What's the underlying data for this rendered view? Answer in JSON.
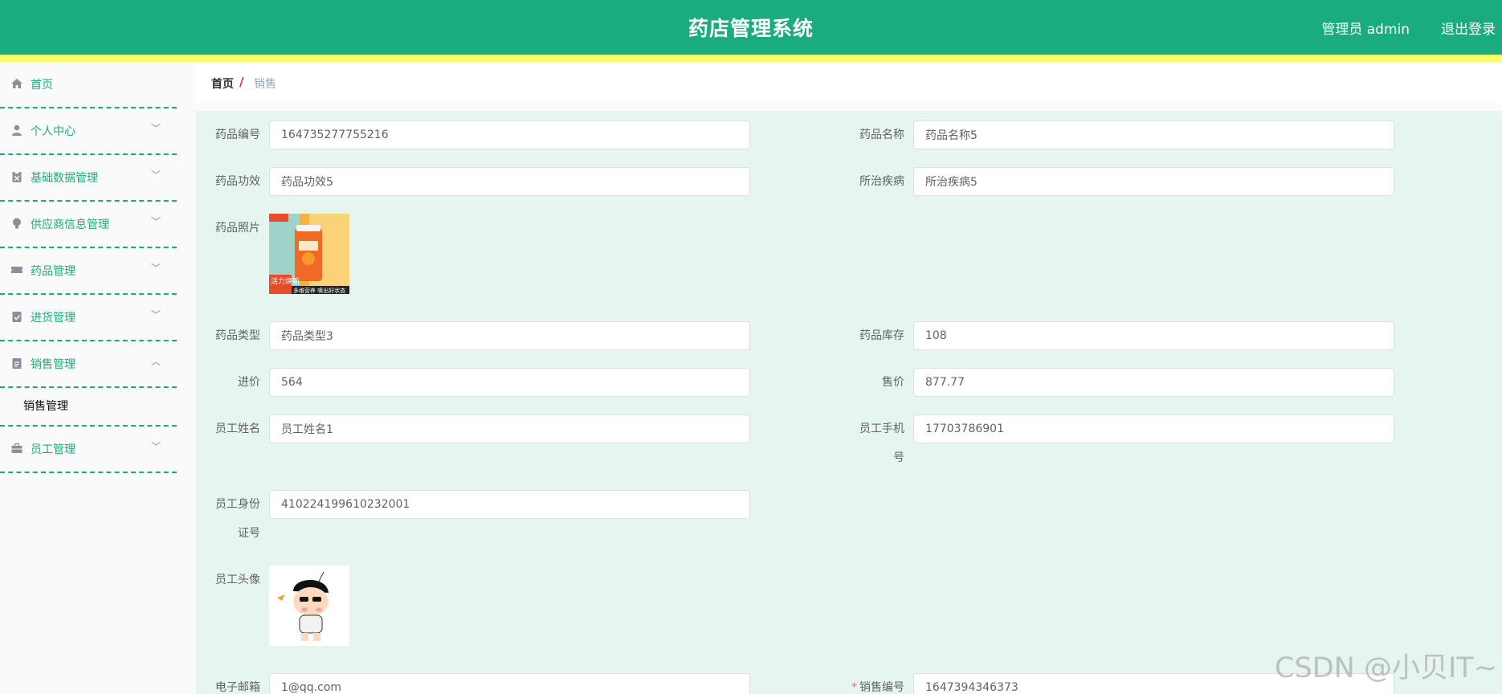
{
  "header": {
    "title": "药店管理系统",
    "admin_label": "管理员 admin",
    "logout_label": "退出登录"
  },
  "sidebar": {
    "items": [
      {
        "label": "首页",
        "icon": "home-icon"
      },
      {
        "label": "个人中心",
        "icon": "user-icon"
      },
      {
        "label": "基础数据管理",
        "icon": "clipboard-icon"
      },
      {
        "label": "供应商信息管理",
        "icon": "bulb-icon"
      },
      {
        "label": "药品管理",
        "icon": "ticket-icon"
      },
      {
        "label": "进货管理",
        "icon": "checklist-icon"
      },
      {
        "label": "销售管理",
        "icon": "document-icon",
        "sub": "销售管理"
      },
      {
        "label": "员工管理",
        "icon": "briefcase-icon"
      }
    ]
  },
  "breadcrumb": {
    "home": "首页",
    "sep": "/",
    "current": "销售"
  },
  "form": {
    "drug_no": {
      "label": "药品编号",
      "value": "164735277755216"
    },
    "drug_name": {
      "label": "药品名称",
      "value": "药品名称5"
    },
    "drug_effect": {
      "label": "药品功效",
      "value": "药品功效5"
    },
    "disease": {
      "label": "所治疾病",
      "value": "所治疾病5"
    },
    "drug_photo": {
      "label": "药品照片",
      "badge": "活力焕新",
      "caption": "多维营养 唤出好状态"
    },
    "drug_type": {
      "label": "药品类型",
      "value": "药品类型3"
    },
    "stock": {
      "label": "药品库存",
      "value": "108"
    },
    "cost": {
      "label": "进价",
      "value": "564"
    },
    "price": {
      "label": "售价",
      "value": "877.77"
    },
    "emp_name": {
      "label": "员工姓名",
      "value": "员工姓名1"
    },
    "emp_phone": {
      "label_1": "员工手机",
      "label_2": "号",
      "value": "17703786901"
    },
    "emp_id": {
      "label_1": "员工身份",
      "label_2": "证号",
      "value": "410224199610232001"
    },
    "emp_avatar": {
      "label": "员工头像"
    },
    "email": {
      "label": "电子邮箱",
      "value": "1@qq.com"
    },
    "sale_no": {
      "required": "*",
      "label": "销售编号",
      "value": "1647394346373"
    }
  },
  "watermark": "CSDN @小贝IT~",
  "colors": {
    "primary": "#1aab7e",
    "accent_bar": "#f9ff6b",
    "content_bg": "#e6f5f0"
  }
}
